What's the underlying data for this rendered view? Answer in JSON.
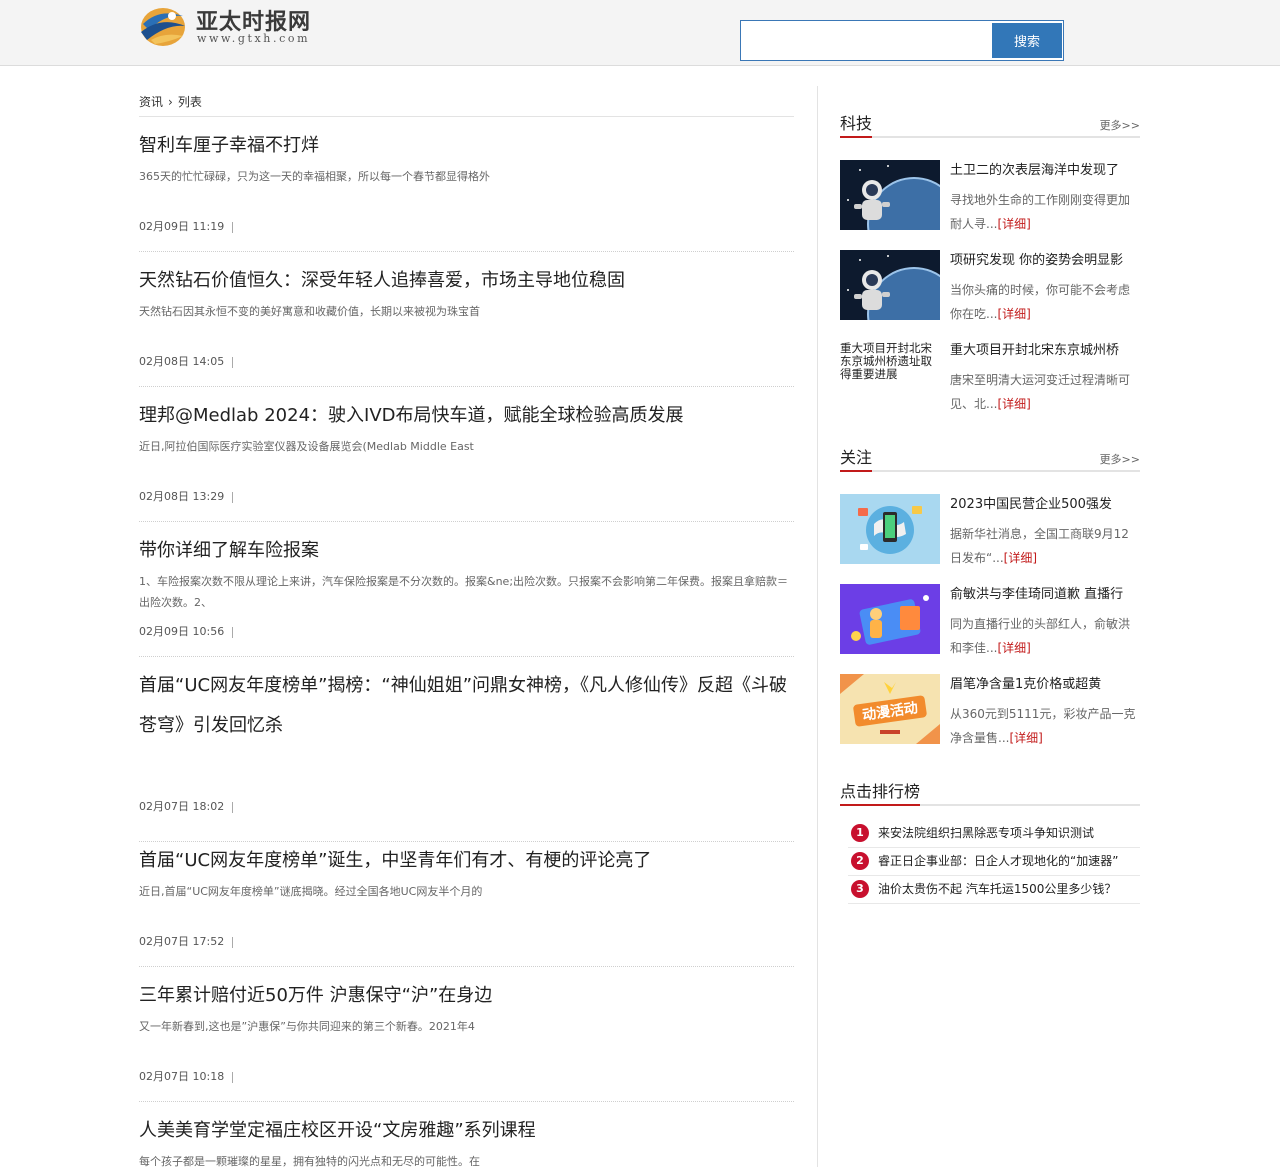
{
  "header": {
    "site_name": "亚太时报网",
    "site_url": "www.gtxh.com",
    "search_placeholder": "",
    "search_button": "搜索"
  },
  "breadcrumb": {
    "root": "资讯",
    "current": "列表"
  },
  "articles": [
    {
      "title": "智利车厘子幸福不打烊",
      "summary": "365天的忙忙碌碌，只为这一天的幸福相聚，所以每一个春节都显得格外",
      "date": "02月09日 11:19"
    },
    {
      "title": "天然钻石价值恒久：深受年轻人追捧喜爱，市场主导地位稳固",
      "summary": "天然钻石因其永恒不变的美好寓意和收藏价值，长期以来被视为珠宝首",
      "date": "02月08日 14:05"
    },
    {
      "title": "理邦@Medlab 2024：驶入IVD布局快车道，赋能全球检验高质发展",
      "summary": "近日,阿拉伯国际医疗实验室仪器及设备展览会(Medlab Middle East",
      "date": "02月08日 13:29"
    },
    {
      "title": "带你详细了解车险报案",
      "summary": "1、车险报案次数不限从理论上来讲，汽车保险报案是不分次数的。报案&ne;出险次数。只报案不会影响第二年保费。报案且拿赔款＝出险次数。2、",
      "date": "02月09日 10:56"
    },
    {
      "title": "首届“UC网友年度榜单”揭榜：“神仙姐姐”问鼎女神榜，《凡人修仙传》反超《斗破苍穹》引发回忆杀",
      "summary": "",
      "date": "02月07日 18:02"
    },
    {
      "title": "首届“UC网友年度榜单”诞生，中坚青年们有才、有梗的评论亮了",
      "summary": "近日,首届“UC网友年度榜单”谜底揭晓。经过全国各地UC网友半个月的",
      "date": "02月07日 17:52"
    },
    {
      "title": "三年累计赔付近50万件 沪惠保守“沪”在身边",
      "summary": "又一年新春到,这也是”沪惠保”与你共同迎来的第三个新春。2021年4",
      "date": "02月07日 10:18"
    },
    {
      "title": "人美美育学堂定福庄校区开设“文房雅趣”系列课程",
      "summary": "每个孩子都是一颗璀璨的星星，拥有独特的闪光点和无尽的可能性。在",
      "date": ""
    }
  ],
  "sidebar": {
    "tech": {
      "title": "科技",
      "more": "更多>>",
      "items": [
        {
          "title": "土卫二的次表层海洋中发现了",
          "desc": "寻找地外生命的工作刚刚变得更加耐人寻...",
          "more": "[详细]",
          "thumb": "astronaut-thumbnail",
          "thumb_text": ""
        },
        {
          "title": "项研究发现 你的姿势会明显影",
          "desc": "当你头痛的时候，你可能不会考虑你在吃...",
          "more": "[详细]",
          "thumb": "astronaut-thumbnail",
          "thumb_text": ""
        },
        {
          "title": "重大项目开封北宋东京城州桥",
          "desc": "唐宋至明清大运河变迁过程清晰可见、北...",
          "more": "[详细]",
          "thumb": "",
          "thumb_text": "重大项目开封北宋东京城州桥遗址取得重要进展"
        }
      ]
    },
    "focus": {
      "title": "关注",
      "more": "更多>>",
      "items": [
        {
          "title": "2023中国民营企业500强发",
          "desc": "据新华社消息，全国工商联9月12日发布“...",
          "more": "[详细]",
          "thumb": "globe-phone-thumbnail"
        },
        {
          "title": "俞敏洪与李佳琦同道歉 直播行",
          "desc": "同为直播行业的头部红人，俞敏洪和李佳...",
          "more": "[详细]",
          "thumb": "shopping-illustration-thumbnail"
        },
        {
          "title": "眉笔净含量1克价格或超黄",
          "desc": "从360元到5111元，彩妆产品一克净含量售...",
          "more": "[详细]",
          "thumb": "promo-banner-thumbnail",
          "thumb_text": "动漫活动"
        }
      ]
    },
    "ranking": {
      "title": "点击排行榜",
      "items": [
        {
          "num": "1",
          "text": "来安法院组织扫黑除恶专项斗争知识测试"
        },
        {
          "num": "2",
          "text": "睿正日企事业部：日企人才现地化的“加速器”"
        },
        {
          "num": "3",
          "text": "油价太贵伤不起 汽车托运1500公里多少钱？"
        }
      ]
    }
  },
  "colors": {
    "accent_red": "#c21a1a",
    "search_blue": "#3277b8",
    "header_bg": "#f4f4f4"
  }
}
